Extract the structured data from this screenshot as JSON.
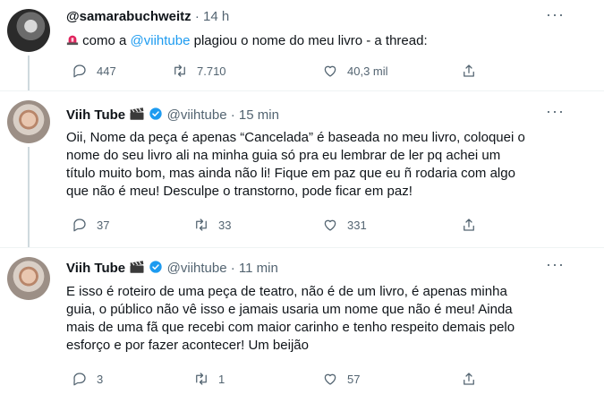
{
  "tweets": [
    {
      "name": "@samarabuchweitz",
      "handle": "",
      "sep": "·",
      "time": "14 h",
      "text_pre": " como a ",
      "mention": "@viihtube",
      "text_post": " plagiou o nome do meu livro - a thread:",
      "replies": "447",
      "retweets": "7.710",
      "likes": "40,3 mil"
    },
    {
      "name": "Viih Tube",
      "handle": "@viihtube",
      "sep": "·",
      "time": "15 min",
      "text_lines": [
        "Oii, Nome da peça é apenas “Cancelada” é baseada no meu livro, coloquei o",
        "nome do seu livro ali na minha guia só pra eu lembrar de ler pq achei um",
        "título muito bom, mas ainda não li! Fique em paz que eu ñ rodaria com algo",
        "que não é meu! Desculpe o transtorno, pode ficar em paz!"
      ],
      "replies": "37",
      "retweets": "33",
      "likes": "331"
    },
    {
      "name": "Viih Tube",
      "handle": "@viihtube",
      "sep": "·",
      "time": "11 min",
      "text_lines": [
        "E isso é roteiro de uma peça de teatro, não é de um livro, é apenas minha",
        "guia, o público não vê isso e jamais usaria um nome que não é meu! Ainda",
        "mais de uma fã que recebi com maior carinho e tenho respeito demais pelo",
        "esforço e por fazer acontecer! Um beijão"
      ],
      "replies": "3",
      "retweets": "1",
      "likes": "57"
    }
  ],
  "icons": {
    "more": "more-dots-icon",
    "reply": "reply-icon",
    "retweet": "retweet-icon",
    "like": "heart-icon",
    "share": "share-icon",
    "verified": "verified-badge-icon",
    "clapper": "clapper-board-emoji",
    "siren": "siren-emoji"
  },
  "colors": {
    "link": "#1d9bf0",
    "muted": "#536471",
    "verified": "#1d9bf0"
  }
}
